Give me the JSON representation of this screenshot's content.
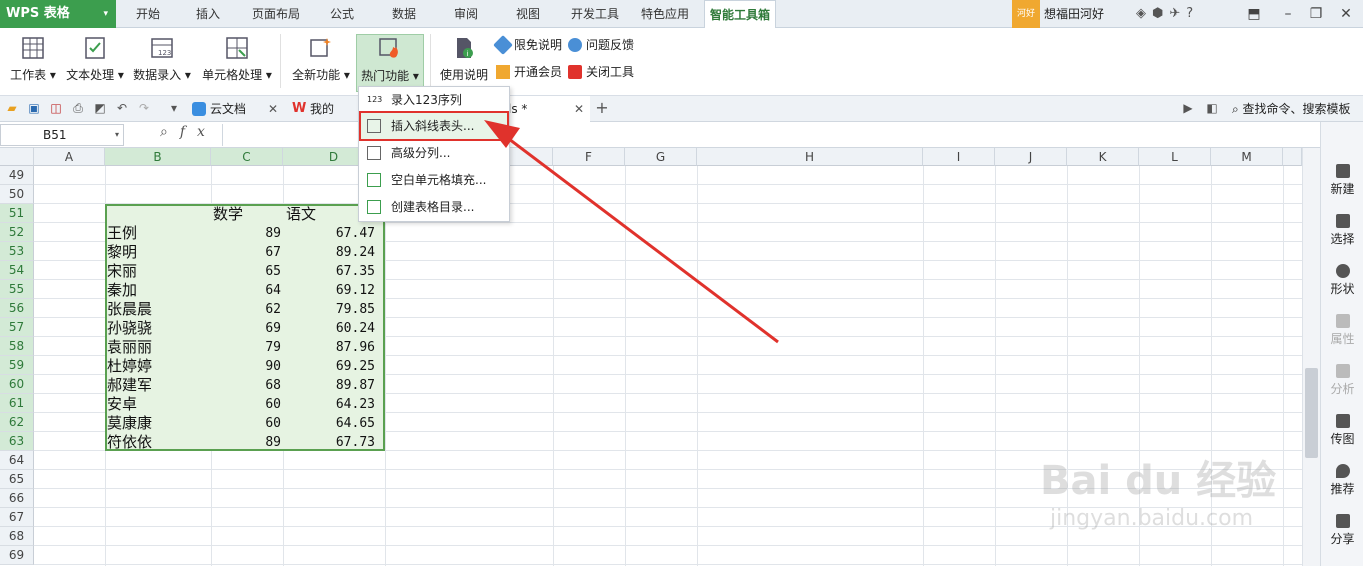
{
  "menubar": {
    "app_label": "WPS 表格",
    "tabs": [
      "开始",
      "插入",
      "页面布局",
      "公式",
      "数据",
      "审阅",
      "视图",
      "开发工具",
      "特色应用",
      "智能工具箱"
    ],
    "active_tab": "智能工具箱",
    "user_badge": "河好",
    "user_name": "想福田河好"
  },
  "ribbon": {
    "buttons": [
      "工作表",
      "文本处理",
      "数据录入",
      "单元格处理",
      "全新功能",
      "热门功能",
      "使用说明"
    ],
    "hot_button": "热门功能",
    "small": [
      "限免说明",
      "问题反馈",
      "开通会员",
      "关闭工具"
    ]
  },
  "tabsbar": {
    "docs": [
      "云文档",
      "我的WPS",
      "ls *"
    ],
    "search_cmd": "查找命令、搜索模板"
  },
  "formula": {
    "name_box": "B51",
    "fx": "fx"
  },
  "columns": [
    "A",
    "B",
    "C",
    "D",
    "E",
    "F",
    "G",
    "H",
    "I",
    "J",
    "K",
    "L",
    "M"
  ],
  "rows": [
    "49",
    "50",
    "51",
    "52",
    "53",
    "54",
    "55",
    "56",
    "57",
    "58",
    "59",
    "60",
    "61",
    "62",
    "63",
    "64",
    "65",
    "66",
    "67",
    "68",
    "69"
  ],
  "table": {
    "header": {
      "c": "数学",
      "d": "语文"
    },
    "records": [
      {
        "name": "王例",
        "math": "89",
        "chinese": "67.47"
      },
      {
        "name": "黎明",
        "math": "67",
        "chinese": "89.24"
      },
      {
        "name": "宋丽",
        "math": "65",
        "chinese": "67.35"
      },
      {
        "name": "秦加",
        "math": "64",
        "chinese": "69.12"
      },
      {
        "name": "张晨晨",
        "math": "62",
        "chinese": "79.85"
      },
      {
        "name": "孙骁骁",
        "math": "69",
        "chinese": "60.24"
      },
      {
        "name": "袁丽丽",
        "math": "79",
        "chinese": "87.96"
      },
      {
        "name": "杜婷婷",
        "math": "90",
        "chinese": "69.25"
      },
      {
        "name": "郝建军",
        "math": "68",
        "chinese": "89.87"
      },
      {
        "name": "安卓",
        "math": "60",
        "chinese": "64.23"
      },
      {
        "name": "莫康康",
        "math": "60",
        "chinese": "64.65"
      },
      {
        "name": "符依依",
        "math": "89",
        "chinese": "67.73"
      }
    ]
  },
  "dropdown": {
    "items": [
      "录入123序列",
      "插入斜线表头...",
      "高级分列...",
      "空白单元格填充...",
      "创建表格目录..."
    ],
    "highlighted": "插入斜线表头..."
  },
  "sidepanel": {
    "items": [
      "新建",
      "选择",
      "形状",
      "属性",
      "分析",
      "传图",
      "推荐",
      "分享"
    ],
    "disabled": [
      "属性",
      "分析"
    ]
  },
  "watermark": {
    "logo": "Bai du 经验",
    "url": "jingyan.baidu.com"
  },
  "colors": {
    "accent_green": "#3c9e4e",
    "selection_fill": "#e6f3e2",
    "arrow_red": "#e0322c"
  }
}
